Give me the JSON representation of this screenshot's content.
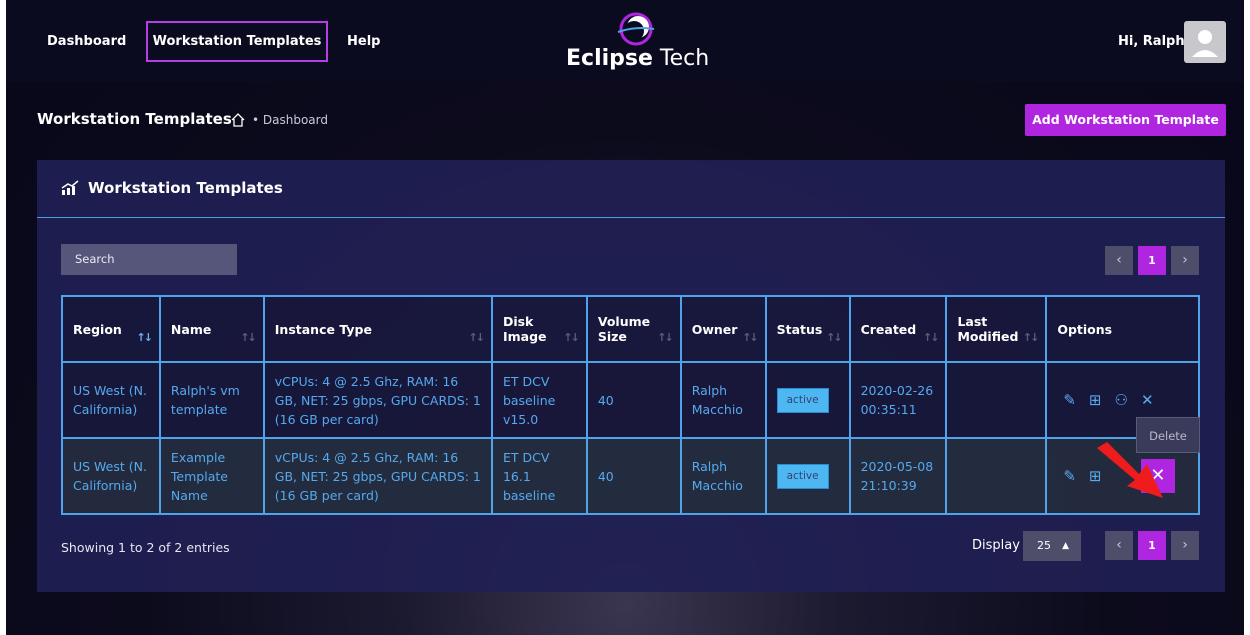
{
  "nav": {
    "items": [
      {
        "label": "Dashboard"
      },
      {
        "label": "Workstation Templates"
      },
      {
        "label": "Help"
      }
    ]
  },
  "brand": {
    "bold": "Eclipse",
    "light": "Tech"
  },
  "user": {
    "greeting": "Hi, Ralph",
    "avatar_icon": "user-avatar-icon"
  },
  "header": {
    "title": "Workstation Templates",
    "breadcrumb": "• Dashboard",
    "home_icon": "home-icon",
    "add_button": "Add Workstation Template"
  },
  "panel": {
    "title": "Workstation Templates",
    "icon": "chart-icon",
    "search_placeholder": "Search"
  },
  "pagination": {
    "prev": "‹",
    "current": "1",
    "next": "›"
  },
  "table": {
    "columns": [
      {
        "label": "Region",
        "sort_active": true
      },
      {
        "label": "Name"
      },
      {
        "label": "Instance Type"
      },
      {
        "label": "Disk Image"
      },
      {
        "label": "Volume Size"
      },
      {
        "label": "Owner"
      },
      {
        "label": "Status"
      },
      {
        "label": "Created"
      },
      {
        "label": "Last Modified"
      },
      {
        "label": "Options"
      }
    ],
    "rows": [
      {
        "region": "US West (N. California)",
        "name": "Ralph's vm template",
        "instance_type": "vCPUs: 4 @ 2.5 Ghz, RAM: 16 GB, NET: 25 gbps, GPU CARDS: 1 (16 GB per card)",
        "disk_image": "ET DCV baseline v15.0",
        "volume_size": "40",
        "owner": "Ralph Macchio",
        "status": "active",
        "created": "2020-02-26 00:35:11",
        "last_modified": ""
      },
      {
        "region": "US West (N. California)",
        "name": "Example Template Name",
        "instance_type": "vCPUs: 4 @ 2.5 Ghz, RAM: 16 GB, NET: 25 gbps, GPU CARDS: 1 (16 GB per card)",
        "disk_image": "ET DCV 16.1 baseline",
        "volume_size": "40",
        "owner": "Ralph Macchio",
        "status": "active",
        "created": "2020-05-08 21:10:39",
        "last_modified": ""
      }
    ],
    "option_icons": [
      "edit-icon",
      "add-icon",
      "users-icon",
      "delete-icon"
    ]
  },
  "tooltip": {
    "label": "Delete"
  },
  "footer": {
    "showing": "Showing 1 to 2 of 2 entries",
    "display_label": "Display",
    "display_value": "25"
  },
  "colors": {
    "accent": "#b025e0",
    "link": "#55a9ee",
    "panel": "#211f54",
    "badge": "#4cb7f0"
  }
}
